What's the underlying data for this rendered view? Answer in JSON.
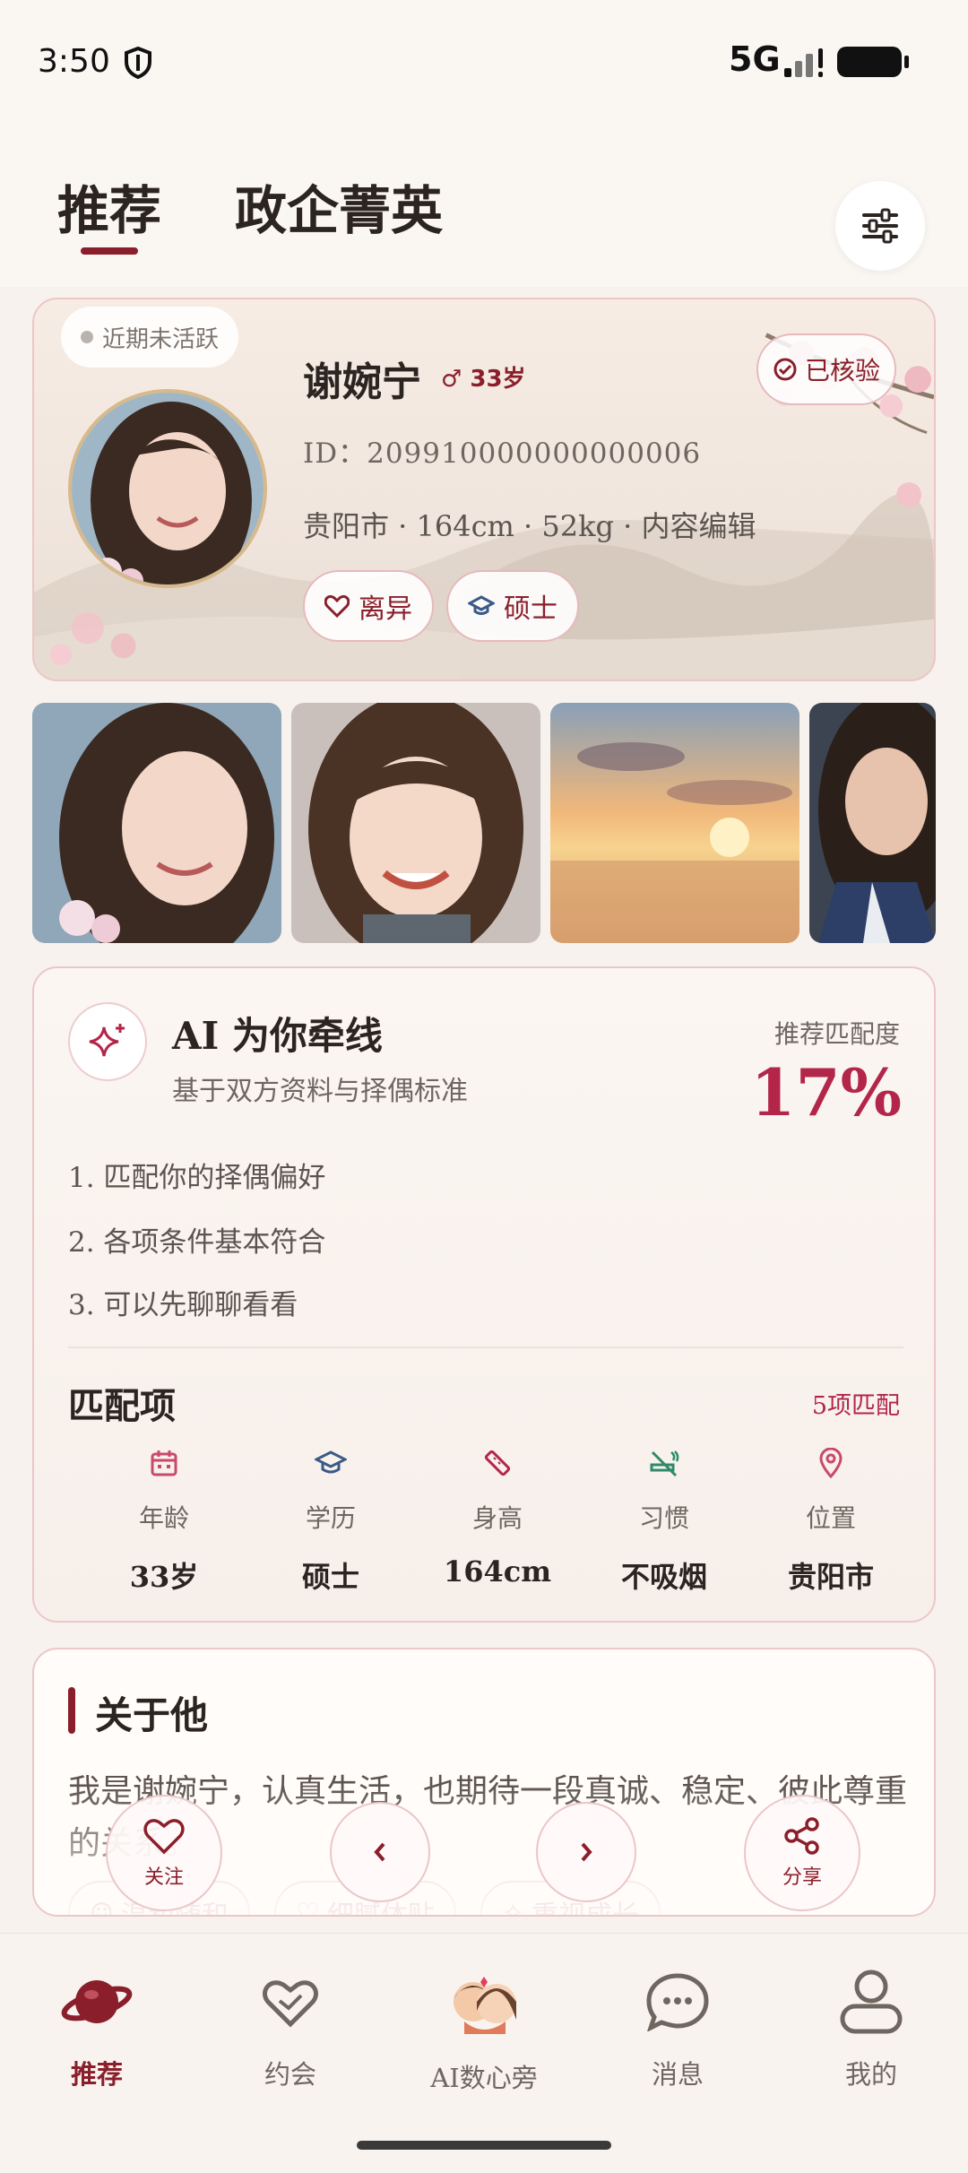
{
  "status_bar": {
    "time": "3:50",
    "network": "5G"
  },
  "header": {
    "tabs": [
      {
        "label": "推荐"
      },
      {
        "label": "政企菁英"
      }
    ]
  },
  "profile": {
    "activity_badge": "近期未活跃",
    "name": "谢婉宁",
    "gender_age": "♂ 33岁",
    "verified_label": "已核验",
    "id_line": "ID：209910000000000006",
    "info_line": "贵阳市 · 164cm · 52kg · 内容编辑",
    "tags": [
      {
        "label": "离异"
      },
      {
        "label": "硕士"
      }
    ]
  },
  "ai_match": {
    "title": "AI 为你牵线",
    "subtitle": "基于双方资料与择偶标准",
    "match_label": "推荐匹配度",
    "match_percent": "17%",
    "reasons": [
      "1.  匹配你的择偶偏好",
      "2.  各项条件基本符合",
      "3.  可以先聊聊看看"
    ],
    "items_title": "匹配项",
    "items_count": "5项匹配",
    "items": [
      {
        "label": "年龄",
        "value": "33岁",
        "icon": "calendar-icon"
      },
      {
        "label": "学历",
        "value": "硕士",
        "icon": "graduation-cap-icon"
      },
      {
        "label": "身高",
        "value": "164cm",
        "icon": "ruler-icon"
      },
      {
        "label": "习惯",
        "value": "不吸烟",
        "icon": "no-smoking-icon"
      },
      {
        "label": "位置",
        "value": "贵阳市",
        "icon": "location-pin-icon"
      }
    ],
    "accent_color": "#b3264a"
  },
  "about": {
    "title": "关于他",
    "text": "我是谢婉宁，认真生活，也期待一段真诚、稳定、彼此尊重的关系。",
    "traits": [
      {
        "label": "温和随和"
      },
      {
        "label": "细腻体贴"
      },
      {
        "label": "重视成长"
      }
    ]
  },
  "actions": {
    "follow_label": "关注",
    "share_label": "分享"
  },
  "bottom_nav": {
    "items": [
      {
        "label": "推荐",
        "active": true
      },
      {
        "label": "约会",
        "active": false
      },
      {
        "label": "AI数心旁",
        "active": false
      },
      {
        "label": "消息",
        "active": false
      },
      {
        "label": "我的",
        "active": false
      }
    ]
  },
  "colors": {
    "brand": "#8a1f2b",
    "background": "#f7f2ee"
  }
}
